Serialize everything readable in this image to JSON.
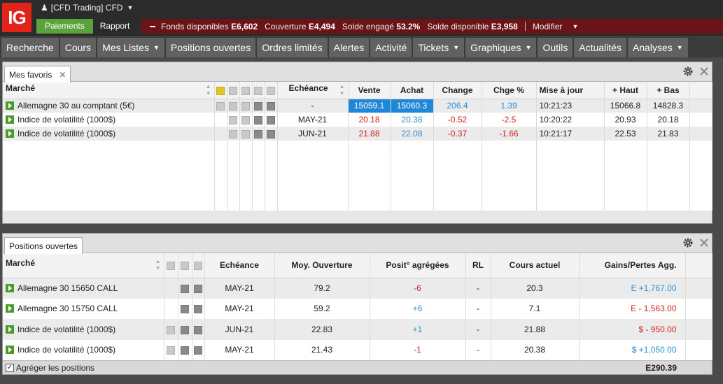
{
  "brand": {
    "logo": "IG",
    "color": "#e2231a"
  },
  "account": {
    "label": "[CFD Trading] CFD"
  },
  "subbar": {
    "payments": "Paiements",
    "report": "Rapport"
  },
  "funds": [
    {
      "label": "Fonds disponibles",
      "value": "E6,602"
    },
    {
      "label": "Couverture",
      "value": "E4,494"
    },
    {
      "label": "Solde engagé",
      "value": "53.2%"
    },
    {
      "label": "Solde disponible",
      "value": "E3,958"
    }
  ],
  "modify": "Modifier",
  "nav": [
    {
      "label": "Recherche",
      "dropdown": false
    },
    {
      "label": "Cours",
      "dropdown": false
    },
    {
      "label": "Mes Listes",
      "dropdown": true
    },
    {
      "label": "Positions ouvertes",
      "dropdown": false
    },
    {
      "label": "Ordres limités",
      "dropdown": false
    },
    {
      "label": "Alertes",
      "dropdown": false
    },
    {
      "label": "Activité",
      "dropdown": false
    },
    {
      "label": "Tickets",
      "dropdown": true
    },
    {
      "label": "Graphiques",
      "dropdown": true
    },
    {
      "label": "Outils",
      "dropdown": false
    },
    {
      "label": "Actualités",
      "dropdown": false
    },
    {
      "label": "Analyses",
      "dropdown": true
    }
  ],
  "favorites": {
    "tab": "Mes favoris",
    "headers": {
      "market": "Marché",
      "expiry": "Echéance",
      "sell": "Vente",
      "buy": "Achat",
      "change": "Change",
      "change_pct": "Chge %",
      "update": "Mise à jour",
      "high": "+ Haut",
      "low": "+ Bas"
    },
    "rows": [
      {
        "market": "Allemagne 30 au comptant (5€)",
        "expiry": "-",
        "sell": "15059.1",
        "buy": "15060.3",
        "change": "206.4",
        "change_pct": "1.39",
        "update": "10:21:23",
        "high": "15066.8",
        "low": "14828.3",
        "sign": "pos",
        "highlight": true
      },
      {
        "market": "Indice de volatilité (1000$)",
        "expiry": "MAY-21",
        "sell": "20.18",
        "buy": "20.38",
        "change": "-0.52",
        "change_pct": "-2.5",
        "update": "10:20:22",
        "high": "20.93",
        "low": "20.18",
        "sign": "neg",
        "highlight": false
      },
      {
        "market": "Indice de volatilité (1000$)",
        "expiry": "JUN-21",
        "sell": "21.88",
        "buy": "22.08",
        "change": "-0.37",
        "change_pct": "-1.66",
        "update": "10:21:17",
        "high": "22.53",
        "low": "21.83",
        "sign": "neg",
        "highlight": false
      }
    ]
  },
  "positions": {
    "tab": "Positions ouvertes",
    "headers": {
      "market": "Marché",
      "expiry": "Echéance",
      "avg_open": "Moy. Ouverture",
      "aggregated": "Posit° agrégées",
      "rl": "RL",
      "current": "Cours actuel",
      "pnl": "Gains/Pertes Agg."
    },
    "rows": [
      {
        "market": "Allemagne 30 15650 CALL",
        "expiry": "MAY-21",
        "avg_open": "79.2",
        "aggregated": "-6",
        "rl": "-",
        "current": "20.3",
        "pnl": "E +1,767.00",
        "agg_sign": "neg",
        "pnl_sign": "pos",
        "note": false
      },
      {
        "market": "Allemagne 30 15750 CALL",
        "expiry": "MAY-21",
        "avg_open": "59.2",
        "aggregated": "+6",
        "rl": "-",
        "current": "7.1",
        "pnl": "E - 1,563.00",
        "agg_sign": "pos",
        "pnl_sign": "neg",
        "note": false
      },
      {
        "market": "Indice de volatilité (1000$)",
        "expiry": "JUN-21",
        "avg_open": "22.83",
        "aggregated": "+1",
        "rl": "-",
        "current": "21.88",
        "pnl": "$ - 950.00",
        "agg_sign": "pos",
        "pnl_sign": "neg",
        "note": true
      },
      {
        "market": "Indice de volatilité (1000$)",
        "expiry": "MAY-21",
        "avg_open": "21.43",
        "aggregated": "-1",
        "rl": "-",
        "current": "20.38",
        "pnl": "$ +1,050.00",
        "agg_sign": "neg",
        "pnl_sign": "pos",
        "note": true
      }
    ],
    "aggregate_label": "Agréger les positions",
    "total": "E290.39"
  },
  "colors": {
    "positive": "#2b8fcf",
    "negative": "#d4231f",
    "highlight": "#1e88d6",
    "accent_green": "#5aa23b",
    "funds_bar": "#6b1417"
  }
}
